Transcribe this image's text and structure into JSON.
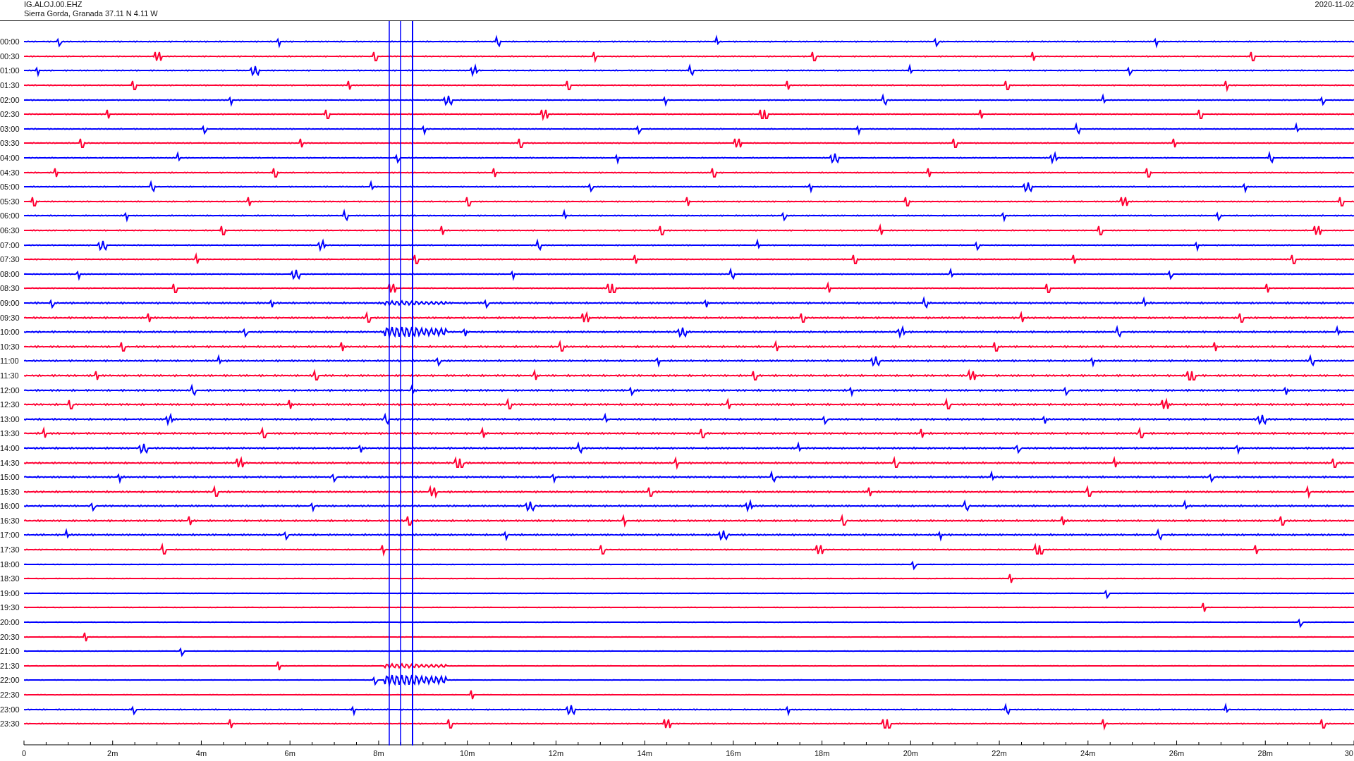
{
  "header": {
    "station": "IG.ALOJ.00.EHZ",
    "location": "Sierra Gorda, Granada  37.11 N 4.11 W",
    "date": "2020-11-02"
  },
  "traces": [
    {
      "time": "00:00",
      "color": "#0000ff"
    },
    {
      "time": "00:30",
      "color": "#ff0033"
    },
    {
      "time": "01:00",
      "color": "#0000ff"
    },
    {
      "time": "01:30",
      "color": "#ff0033"
    },
    {
      "time": "02:00",
      "color": "#0000ff"
    },
    {
      "time": "02:30",
      "color": "#ff0033"
    },
    {
      "time": "03:00",
      "color": "#0000ff"
    },
    {
      "time": "03:30",
      "color": "#ff0033"
    },
    {
      "time": "04:00",
      "color": "#0000ff"
    },
    {
      "time": "04:30",
      "color": "#ff0033"
    },
    {
      "time": "05:00",
      "color": "#0000ff"
    },
    {
      "time": "05:30",
      "color": "#ff0033"
    },
    {
      "time": "06:00",
      "color": "#0000ff"
    },
    {
      "time": "06:30",
      "color": "#ff0033"
    },
    {
      "time": "07:00",
      "color": "#0000ff"
    },
    {
      "time": "07:30",
      "color": "#ff0033"
    },
    {
      "time": "08:00",
      "color": "#0000ff"
    },
    {
      "time": "08:30",
      "color": "#ff0033"
    },
    {
      "time": "09:00",
      "color": "#0000ff"
    },
    {
      "time": "09:30",
      "color": "#ff0033"
    },
    {
      "time": "10:00",
      "color": "#0000ff"
    },
    {
      "time": "10:30",
      "color": "#ff0033"
    },
    {
      "time": "11:00",
      "color": "#0000ff"
    },
    {
      "time": "11:30",
      "color": "#ff0033"
    },
    {
      "time": "12:00",
      "color": "#0000ff"
    },
    {
      "time": "12:30",
      "color": "#ff0033"
    },
    {
      "time": "13:00",
      "color": "#0000ff"
    },
    {
      "time": "13:30",
      "color": "#ff0033"
    },
    {
      "time": "14:00",
      "color": "#0000ff"
    },
    {
      "time": "14:30",
      "color": "#ff0033"
    },
    {
      "time": "15:00",
      "color": "#0000ff"
    },
    {
      "time": "15:30",
      "color": "#ff0033"
    },
    {
      "time": "16:00",
      "color": "#0000ff"
    },
    {
      "time": "16:30",
      "color": "#ff0033"
    },
    {
      "time": "17:00",
      "color": "#0000ff"
    },
    {
      "time": "17:30",
      "color": "#ff0033"
    },
    {
      "time": "18:00",
      "color": "#0000ff"
    },
    {
      "time": "18:30",
      "color": "#ff0033"
    },
    {
      "time": "19:00",
      "color": "#0000ff"
    },
    {
      "time": "19:30",
      "color": "#ff0033"
    },
    {
      "time": "20:00",
      "color": "#0000ff"
    },
    {
      "time": "20:30",
      "color": "#ff0033"
    },
    {
      "time": "21:00",
      "color": "#0000ff"
    },
    {
      "time": "21:30",
      "color": "#ff0033"
    },
    {
      "time": "22:00",
      "color": "#0000ff"
    },
    {
      "time": "22:30",
      "color": "#ff0033"
    },
    {
      "time": "23:00",
      "color": "#0000ff"
    },
    {
      "time": "23:30",
      "color": "#ff0033"
    }
  ],
  "time_axis": {
    "labels": [
      "0",
      "2m",
      "4m",
      "6m",
      "8m",
      "10m",
      "12m",
      "14m",
      "16m",
      "18m",
      "20m",
      "22m",
      "24m",
      "26m",
      "28m",
      "30"
    ]
  }
}
